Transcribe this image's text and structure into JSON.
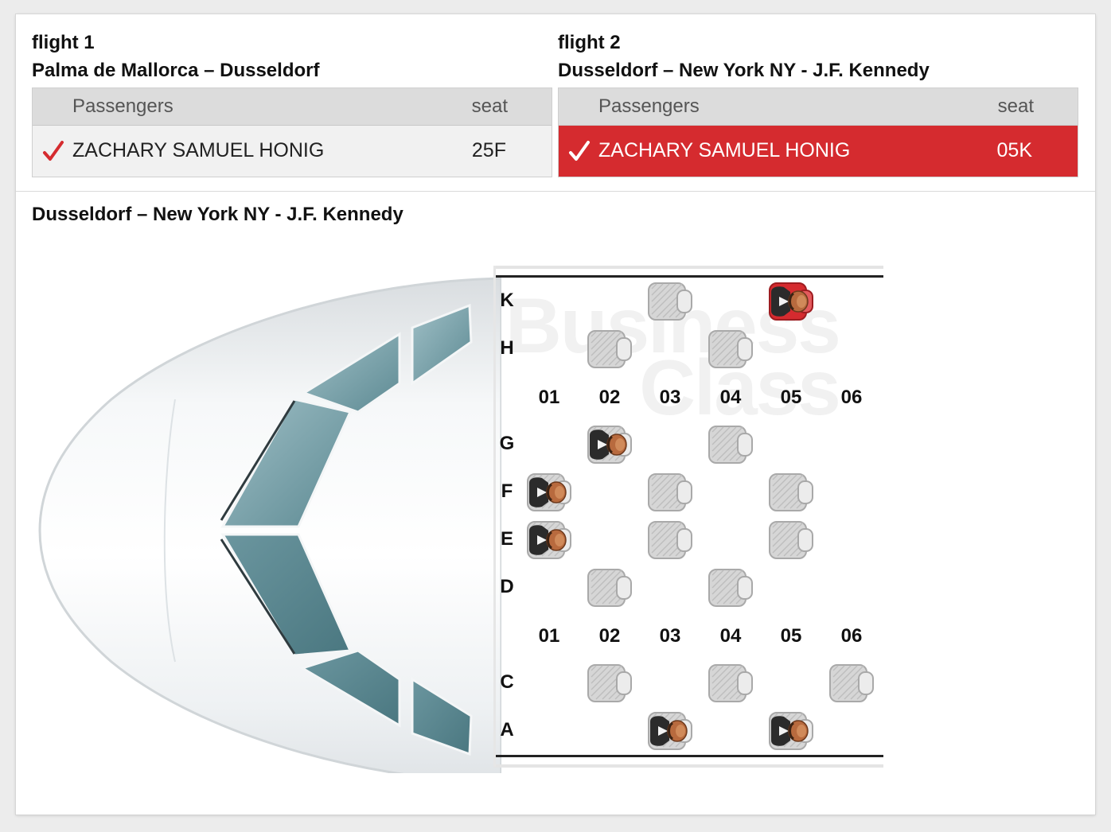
{
  "flights": [
    {
      "label": "flight 1",
      "route": "Palma de Mallorca – Dusseldorf",
      "headers": {
        "passengers": "Passengers",
        "seat": "seat"
      },
      "passenger": {
        "name": "ZACHARY SAMUEL HONIG",
        "seat": "25F",
        "selected": false
      }
    },
    {
      "label": "flight 2",
      "route": "Dusseldorf – New York NY - J.F. Kennedy",
      "headers": {
        "passengers": "Passengers",
        "seat": "seat"
      },
      "passenger": {
        "name": "ZACHARY SAMUEL HONIG",
        "seat": "05K",
        "selected": true
      }
    }
  ],
  "seat_map": {
    "route": "Dusseldorf – New York NY - J.F. Kennedy",
    "watermark": [
      "Business",
      "Class"
    ],
    "columns": [
      "01",
      "02",
      "03",
      "04",
      "05",
      "06"
    ],
    "row_letters": [
      "K",
      "H",
      "G",
      "F",
      "E",
      "D",
      "C",
      "A"
    ],
    "seats": [
      {
        "id": "03K",
        "row": "K",
        "col": "03",
        "state": "available"
      },
      {
        "id": "05K",
        "row": "K",
        "col": "05",
        "state": "selected"
      },
      {
        "id": "02H",
        "row": "H",
        "col": "02",
        "state": "available"
      },
      {
        "id": "04H",
        "row": "H",
        "col": "04",
        "state": "available"
      },
      {
        "id": "02G",
        "row": "G",
        "col": "02",
        "state": "occupied"
      },
      {
        "id": "04G",
        "row": "G",
        "col": "04",
        "state": "available"
      },
      {
        "id": "01F",
        "row": "F",
        "col": "01",
        "state": "occupied"
      },
      {
        "id": "03F",
        "row": "F",
        "col": "03",
        "state": "available"
      },
      {
        "id": "05F",
        "row": "F",
        "col": "05",
        "state": "available"
      },
      {
        "id": "01E",
        "row": "E",
        "col": "01",
        "state": "occupied"
      },
      {
        "id": "03E",
        "row": "E",
        "col": "03",
        "state": "available"
      },
      {
        "id": "05E",
        "row": "E",
        "col": "05",
        "state": "available"
      },
      {
        "id": "02D",
        "row": "D",
        "col": "02",
        "state": "available"
      },
      {
        "id": "04D",
        "row": "D",
        "col": "04",
        "state": "available"
      },
      {
        "id": "02C",
        "row": "C",
        "col": "02",
        "state": "available"
      },
      {
        "id": "04C",
        "row": "C",
        "col": "04",
        "state": "available"
      },
      {
        "id": "06C",
        "row": "C",
        "col": "06",
        "state": "available"
      },
      {
        "id": "03A",
        "row": "A",
        "col": "03",
        "state": "occupied"
      },
      {
        "id": "05A",
        "row": "A",
        "col": "05",
        "state": "occupied"
      }
    ]
  },
  "colors": {
    "selected_red": "#d52b2f",
    "check_red": "#d52b2f"
  }
}
